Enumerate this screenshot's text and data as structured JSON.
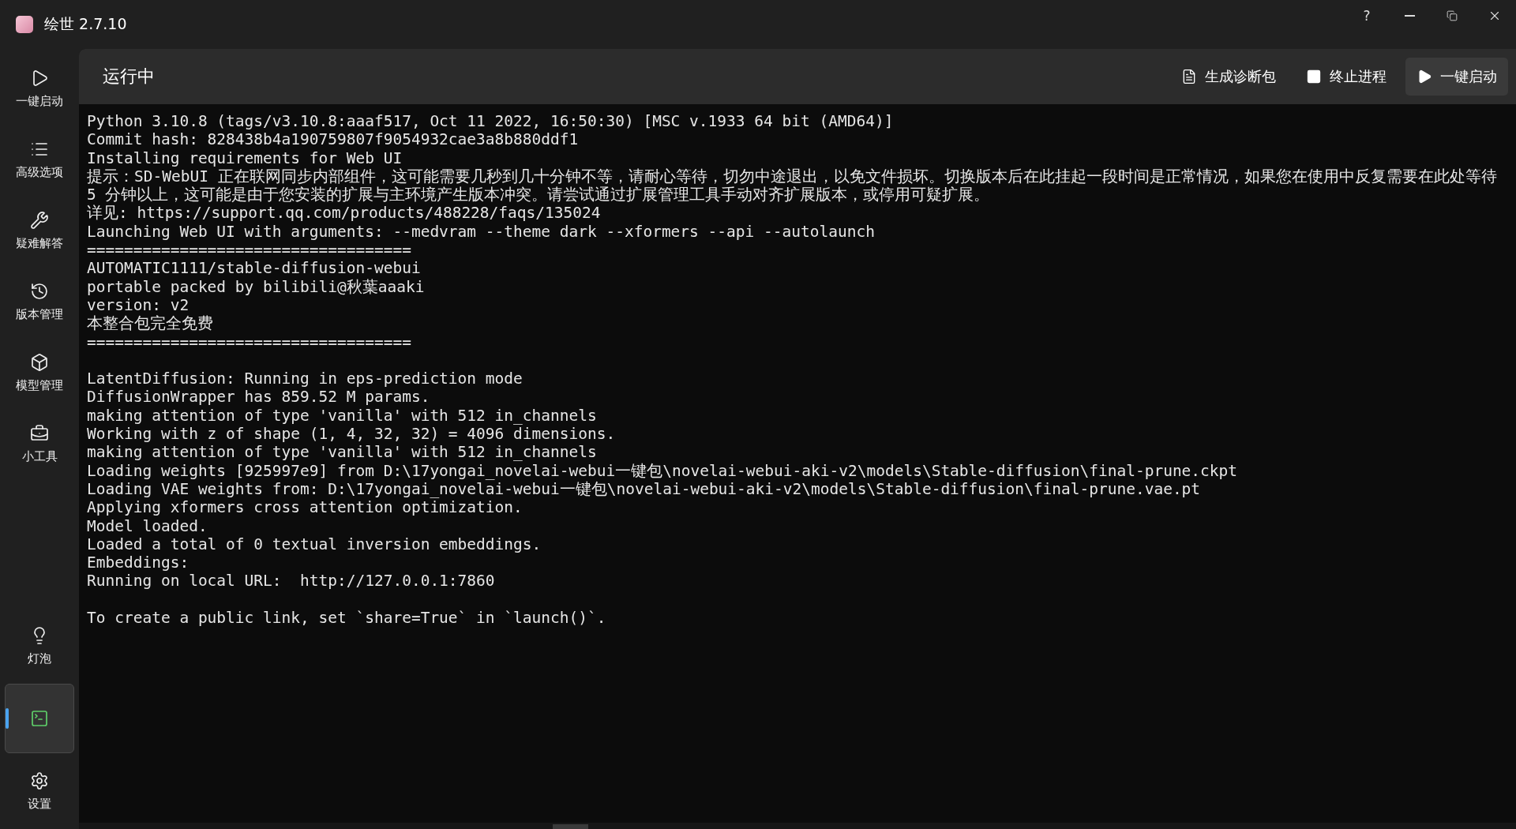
{
  "window": {
    "title": "绘世 2.7.10",
    "controls": [
      "?"
    ]
  },
  "sidebar": {
    "items": [
      {
        "label": "一键启动",
        "selected": false
      },
      {
        "label": "高级选项",
        "selected": false
      },
      {
        "label": "疑难解答",
        "selected": false
      },
      {
        "label": "版本管理",
        "selected": false
      },
      {
        "label": "模型管理",
        "selected": false
      },
      {
        "label": "小工具",
        "selected": false
      }
    ],
    "bottom_items": [
      {
        "label": "灯泡",
        "selected": false
      },
      {
        "selected": true
      },
      {
        "label": "设置",
        "selected": false
      }
    ]
  },
  "header": {
    "title": "运行中",
    "buttons": [
      {
        "label": "生成诊断包",
        "kind": "plain"
      },
      {
        "label": "终止进程",
        "kind": "plain"
      },
      {
        "label": "一键启动",
        "kind": "filled"
      }
    ]
  },
  "console": {
    "blocks": [
      [
        "Python 3.10.8 (tags/v3.10.8:aaaf517, Oct 11 2022, 16:50:30) [MSC v.1933 64 bit (AMD64)]",
        "Commit hash: 828438b4a190759807f9054932cae3a8b880ddf1",
        "Installing requirements for Web UI",
        "提示：SD-WebUI 正在联网同步内部组件，这可能需要几秒到几十分钟不等，请耐心等待，切勿中途退出，以免文件损坏。切换版本后在此挂起一段时间是正常情况，如果您在使用中反复需要在此处等待",
        "5 分钟以上，这可能是由于您安装的扩展与主环境产生版本冲突。请尝试通过扩展管理工具手动对齐扩展版本，或停用可疑扩展。",
        "详见: https://support.qq.com/products/488228/faqs/135024",
        "Launching Web UI with arguments: --medvram --theme dark --xformers --api --autolaunch",
        "===================================",
        "AUTOMATIC1111/stable-diffusion-webui",
        "portable packed by bilibili@秋葉aaaki",
        "version: v2",
        "本整合包完全免费",
        "==================================="
      ],
      [
        "LatentDiffusion: Running in eps-prediction mode",
        "DiffusionWrapper has 859.52 M params.",
        "making attention of type 'vanilla' with 512 in_channels",
        "Working with z of shape (1, 4, 32, 32) = 4096 dimensions.",
        "making attention of type 'vanilla' with 512 in_channels",
        "Loading weights [925997e9] from D:\\17yongai_novelai-webui一键包\\novelai-webui-aki-v2\\models\\Stable-diffusion\\final-prune.ckpt",
        "Loading VAE weights from: D:\\17yongai_novelai-webui一键包\\novelai-webui-aki-v2\\models\\Stable-diffusion\\final-prune.vae.pt",
        "Applying xformers cross attention optimization.",
        "Model loaded.",
        "Loaded a total of 0 textual inversion embeddings.",
        "Embeddings:",
        "Running on local URL:  http://127.0.0.1:7860"
      ],
      [
        "To create a public link, set `share=True` in `launch()`."
      ]
    ]
  }
}
